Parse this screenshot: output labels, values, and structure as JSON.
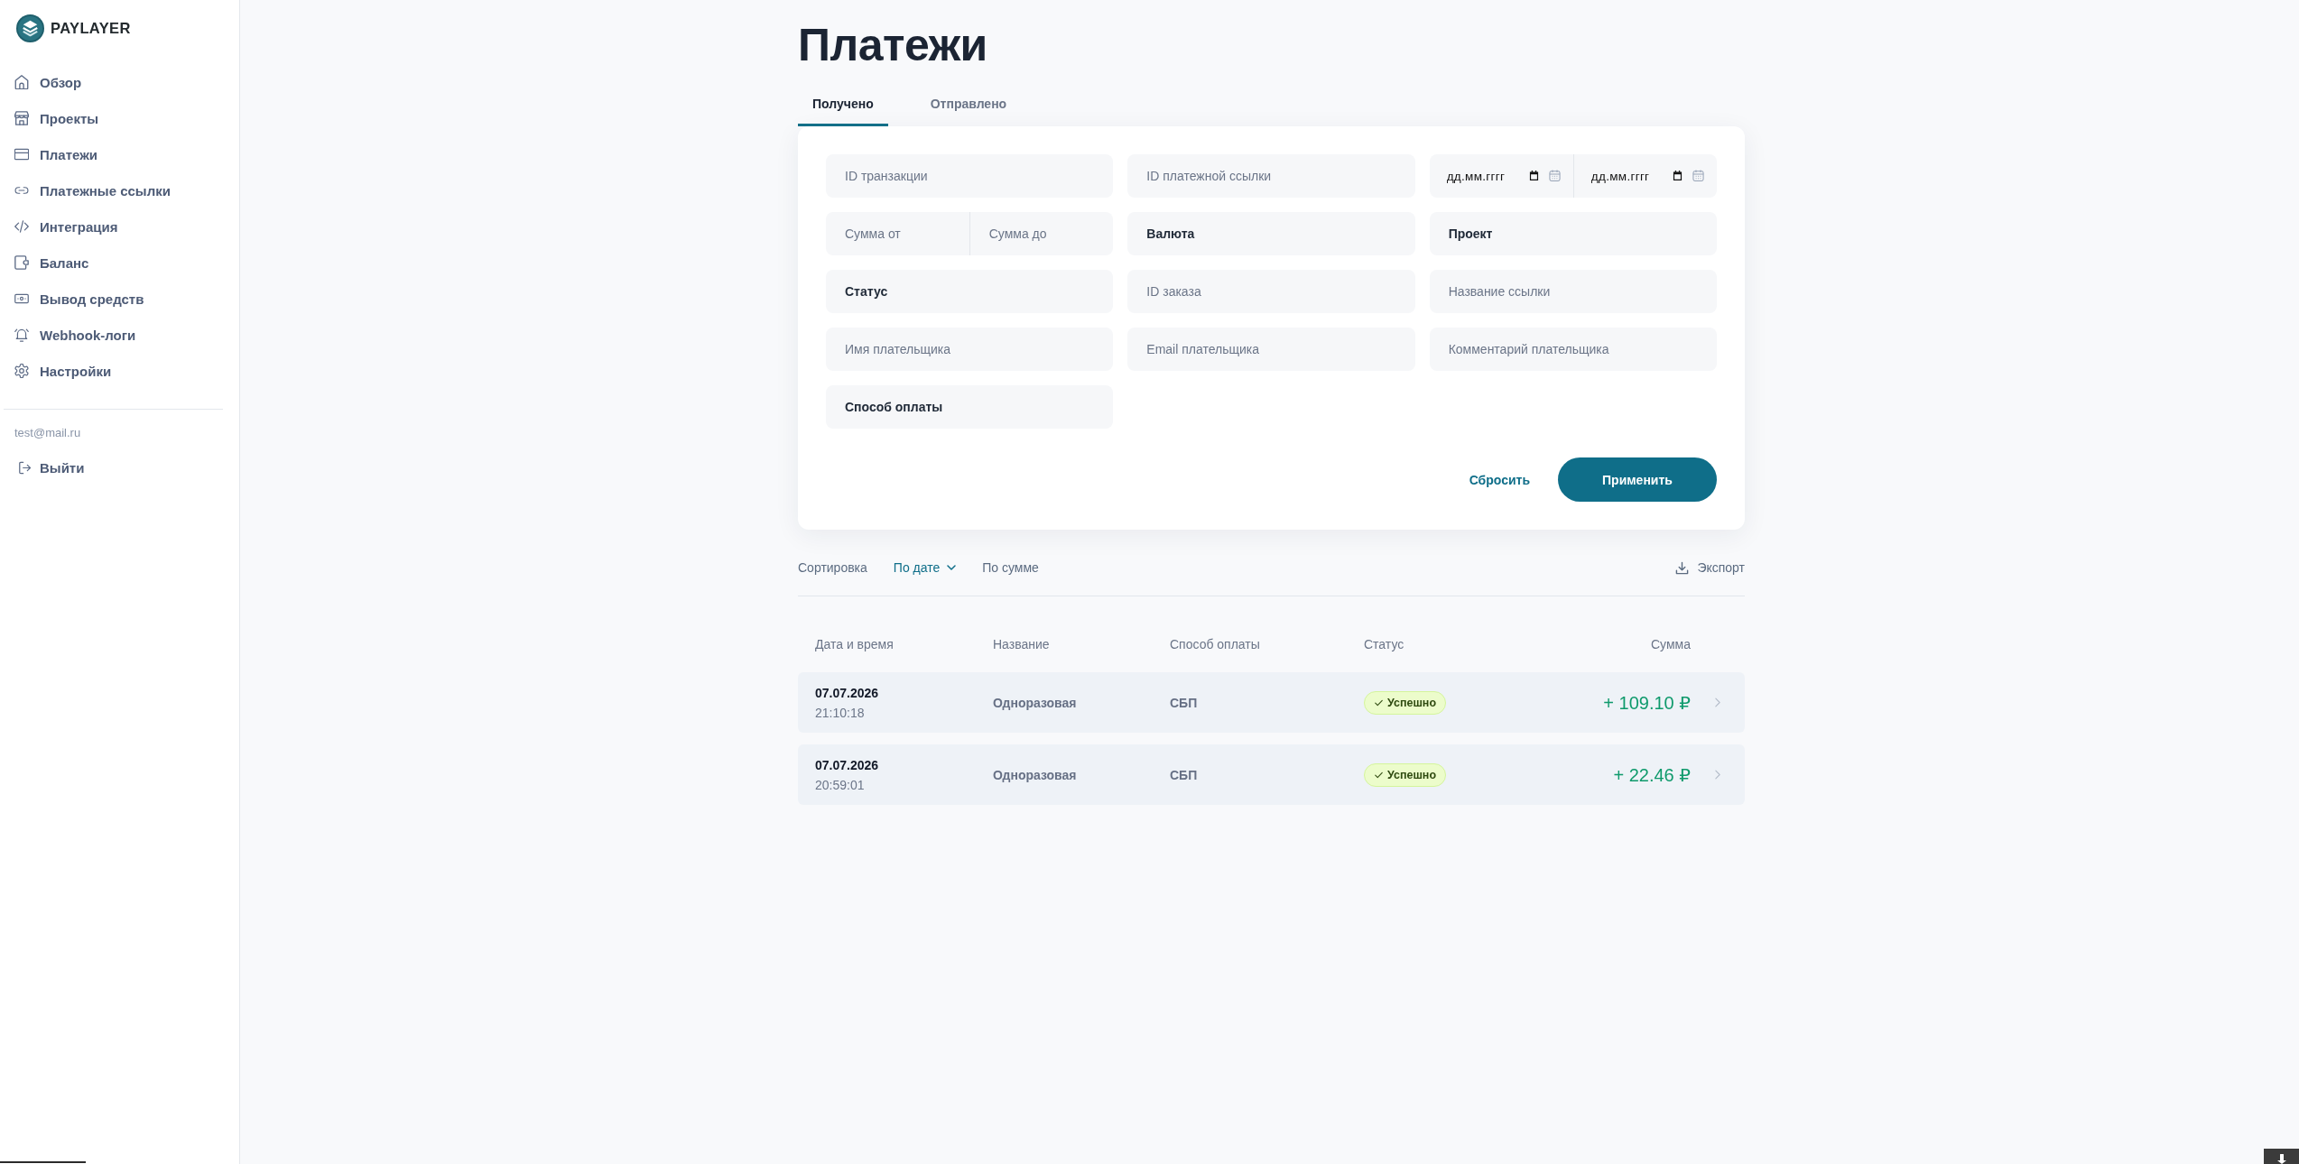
{
  "sidebar": {
    "logo_text": "PAYLAYER",
    "items": [
      {
        "label": "Обзор"
      },
      {
        "label": "Проекты"
      },
      {
        "label": "Платежи"
      },
      {
        "label": "Платежные ссылки"
      },
      {
        "label": "Интеграция"
      },
      {
        "label": "Баланс"
      },
      {
        "label": "Вывод средств"
      },
      {
        "label": "Webhook-логи"
      },
      {
        "label": "Настройки"
      }
    ],
    "user_email": "test@mail.ru",
    "logout": "Выйти"
  },
  "title": "Платежи",
  "tabs": [
    {
      "label": "Получено",
      "selected": true
    },
    {
      "label": "Отправлено",
      "selected": false
    }
  ],
  "filters": {
    "fields": [
      {
        "kind": "text",
        "placeholder": "ID транзакции"
      },
      {
        "kind": "text",
        "placeholder": "ID платежной ссылки"
      },
      {
        "kind": "date_range",
        "parts": [
          {
            "placeholder": "дд.мм.гггг"
          },
          {
            "placeholder": "дд.мм.гггг"
          }
        ]
      },
      {
        "kind": "range",
        "parts": [
          {
            "placeholder": "Сумма от"
          },
          {
            "placeholder": "Сумма до"
          }
        ]
      },
      {
        "kind": "select",
        "label": "Валюта"
      },
      {
        "kind": "select",
        "label": "Проект"
      },
      {
        "kind": "select",
        "label": "Статус"
      },
      {
        "kind": "text",
        "placeholder": "ID заказа"
      },
      {
        "kind": "text",
        "placeholder": "Название ссылки"
      },
      {
        "kind": "text",
        "placeholder": "Имя плательщика"
      },
      {
        "kind": "text",
        "placeholder": "Email плательщика"
      },
      {
        "kind": "text",
        "placeholder": "Комментарий плательщика"
      },
      {
        "kind": "select",
        "label": "Способ оплаты"
      }
    ],
    "reset_button": "Сбросить",
    "apply_button": "Применить"
  },
  "sort": {
    "label": "Сортировка",
    "options": [
      {
        "label": "По дате",
        "selected": true
      },
      {
        "label": "По сумме",
        "selected": false
      }
    ],
    "export_button": "Экспорт"
  },
  "table": {
    "columns": [
      "Дата и время",
      "Название",
      "Способ оплаты",
      "Статус",
      "Сумма"
    ],
    "rows": [
      {
        "date": "07.07.2026",
        "time": "21:10:18",
        "name": "Одноразовая",
        "method": "СБП",
        "status": {
          "label": "Успешно",
          "kind": "success"
        },
        "amount": "+ 109.10 ₽"
      },
      {
        "date": "07.07.2026",
        "time": "20:59:01",
        "name": "Одноразовая",
        "method": "СБП",
        "status": {
          "label": "Успешно",
          "kind": "success"
        },
        "amount": "+ 22.46 ₽"
      }
    ]
  }
}
